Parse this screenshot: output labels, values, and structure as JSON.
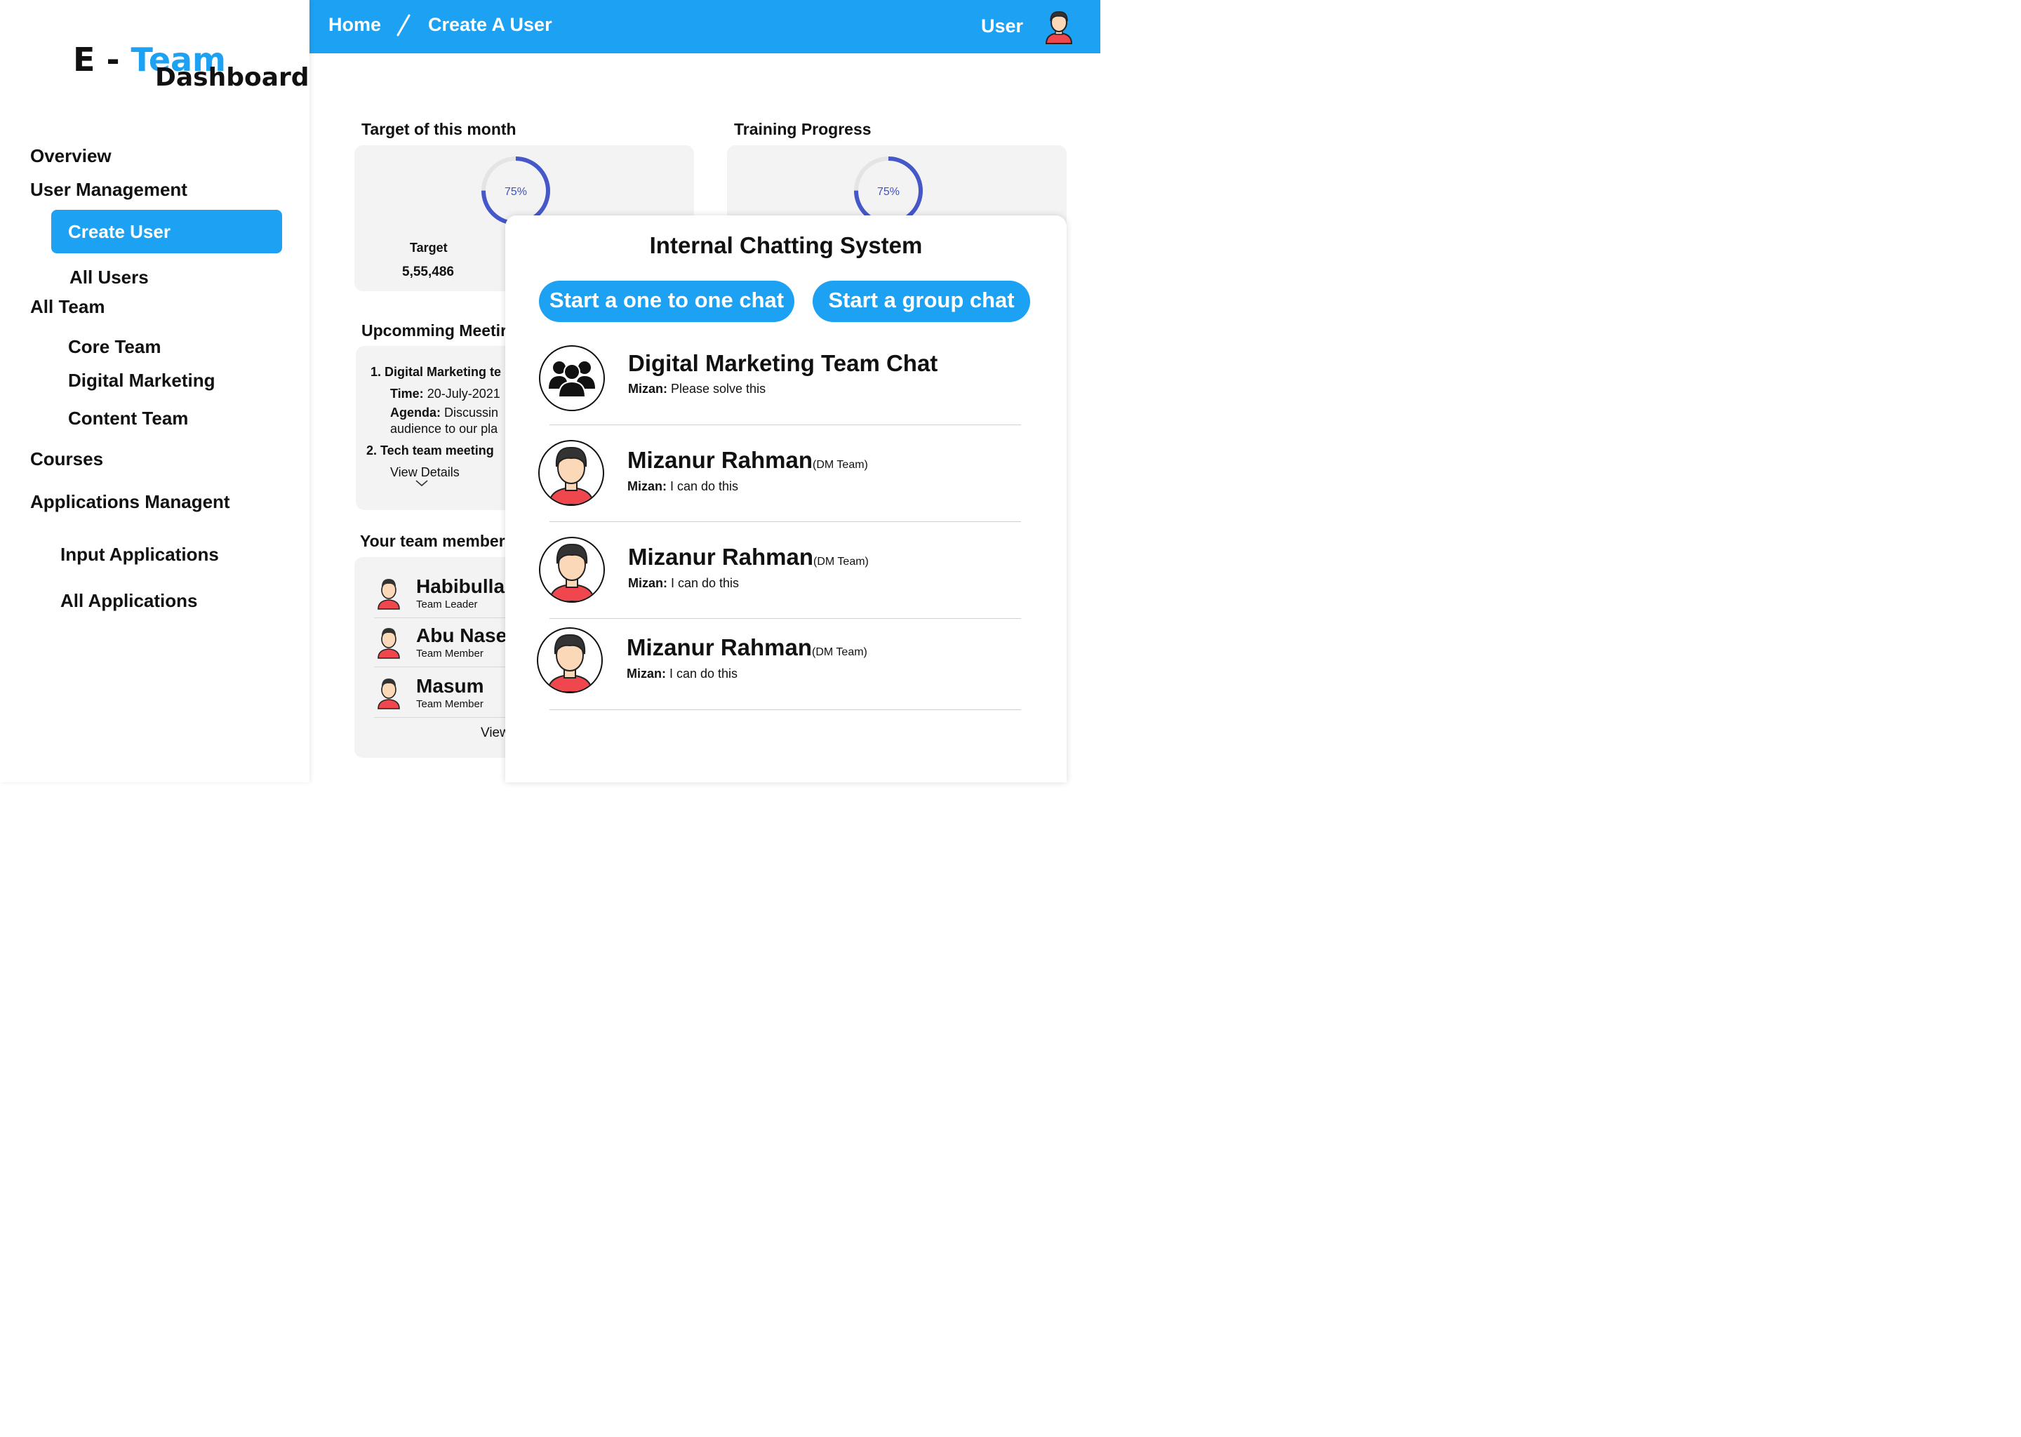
{
  "brand": {
    "prefix": "E - ",
    "accent": "Team",
    "sub": "Dashboard",
    "accent_color": "#1da1f2"
  },
  "sidebar": {
    "overview": "Overview",
    "user_management": "User Management",
    "create_user": "Create User",
    "all_users": "All Users",
    "all_team": "All Team",
    "core_team": "Core Team",
    "digital_marketing": "Digital Marketing",
    "content_team": "Content Team",
    "courses": "Courses",
    "applications": "Applications Managent",
    "input_applications": "Input Applications",
    "all_applications": "All Applications"
  },
  "header": {
    "home": "Home",
    "current": "Create A User",
    "user": "User",
    "color": "#1da1f2"
  },
  "target": {
    "title": "Target of this month",
    "progress_label": "75%",
    "progress": 0.75,
    "label": "Target",
    "value": "5,55,486"
  },
  "training": {
    "title": "Training Progress",
    "progress_label": "75%",
    "progress": 0.75
  },
  "meetings": {
    "title": "Upcomming Meetir",
    "item1_num": "1.",
    "item1_title": "Digital Marketing te",
    "item1_time_label": "Time:",
    "item1_time": " 20-July-2021",
    "item1_agenda_label": "Agenda:",
    "item1_agenda": " Discussin",
    "item1_agenda2": "audience to our pla",
    "item2": "2. Tech team meeting",
    "view_details": "View Details"
  },
  "team": {
    "title": "Your team member",
    "members": [
      {
        "name": "Habibullah",
        "role": "Team Leader"
      },
      {
        "name": "Abu Naser",
        "role": "Team Member"
      },
      {
        "name": "Masum",
        "role": "Team Member"
      }
    ],
    "view": "View"
  },
  "chat": {
    "title": "Internal Chatting System",
    "one_to_one": "Start a one to one chat",
    "group": "Start a group chat",
    "items": [
      {
        "name": "Digital Marketing Team Chat",
        "tag": "",
        "sender": "Mizan:",
        "message": " Please solve this"
      },
      {
        "name": "Mizanur Rahman",
        "tag": "(DM Team)",
        "sender": "Mizan:",
        "message": " I can do this"
      },
      {
        "name": "Mizanur Rahman",
        "tag": "(DM Team)",
        "sender": "Mizan:",
        "message": " I can do this"
      },
      {
        "name": "Mizanur Rahman",
        "tag": "(DM Team)",
        "sender": "Mizan:",
        "message": " I can do this"
      }
    ]
  }
}
